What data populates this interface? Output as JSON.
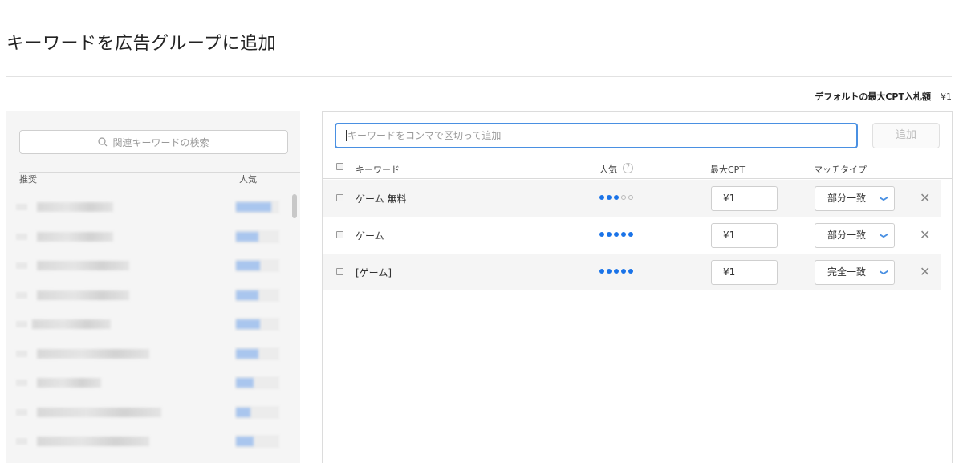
{
  "page": {
    "title": "キーワードを広告グループに追加",
    "default_cpt_label": "デフォルトの最大CPT入札額",
    "default_cpt_value": "¥1"
  },
  "suggestions": {
    "search_placeholder": "関連キーワードの検索",
    "col_recommended": "推奨",
    "col_popularity": "人気",
    "blurred_rows": 9
  },
  "keywords": {
    "input_placeholder": "キーワードをコンマで区切って追加",
    "add_button": "追加",
    "headers": {
      "keyword": "キーワード",
      "popularity": "人気",
      "max_cpt": "最大CPT",
      "match_type": "マッチタイプ"
    },
    "rows": [
      {
        "keyword": "ゲーム 無料",
        "popularity": 3,
        "max_cpt": "¥1",
        "match_type": "部分一致"
      },
      {
        "keyword": "ゲーム",
        "popularity": 5,
        "max_cpt": "¥1",
        "match_type": "部分一致"
      },
      {
        "keyword": "[ゲーム]",
        "popularity": 5,
        "max_cpt": "¥1",
        "match_type": "完全一致"
      }
    ]
  },
  "icons": {
    "search": "search-icon",
    "help": "question-icon",
    "chevron": "chevron-down-icon",
    "remove": "close-icon"
  },
  "colors": {
    "accent": "#4a90e2",
    "popularity_dot": "#1a73e8"
  }
}
